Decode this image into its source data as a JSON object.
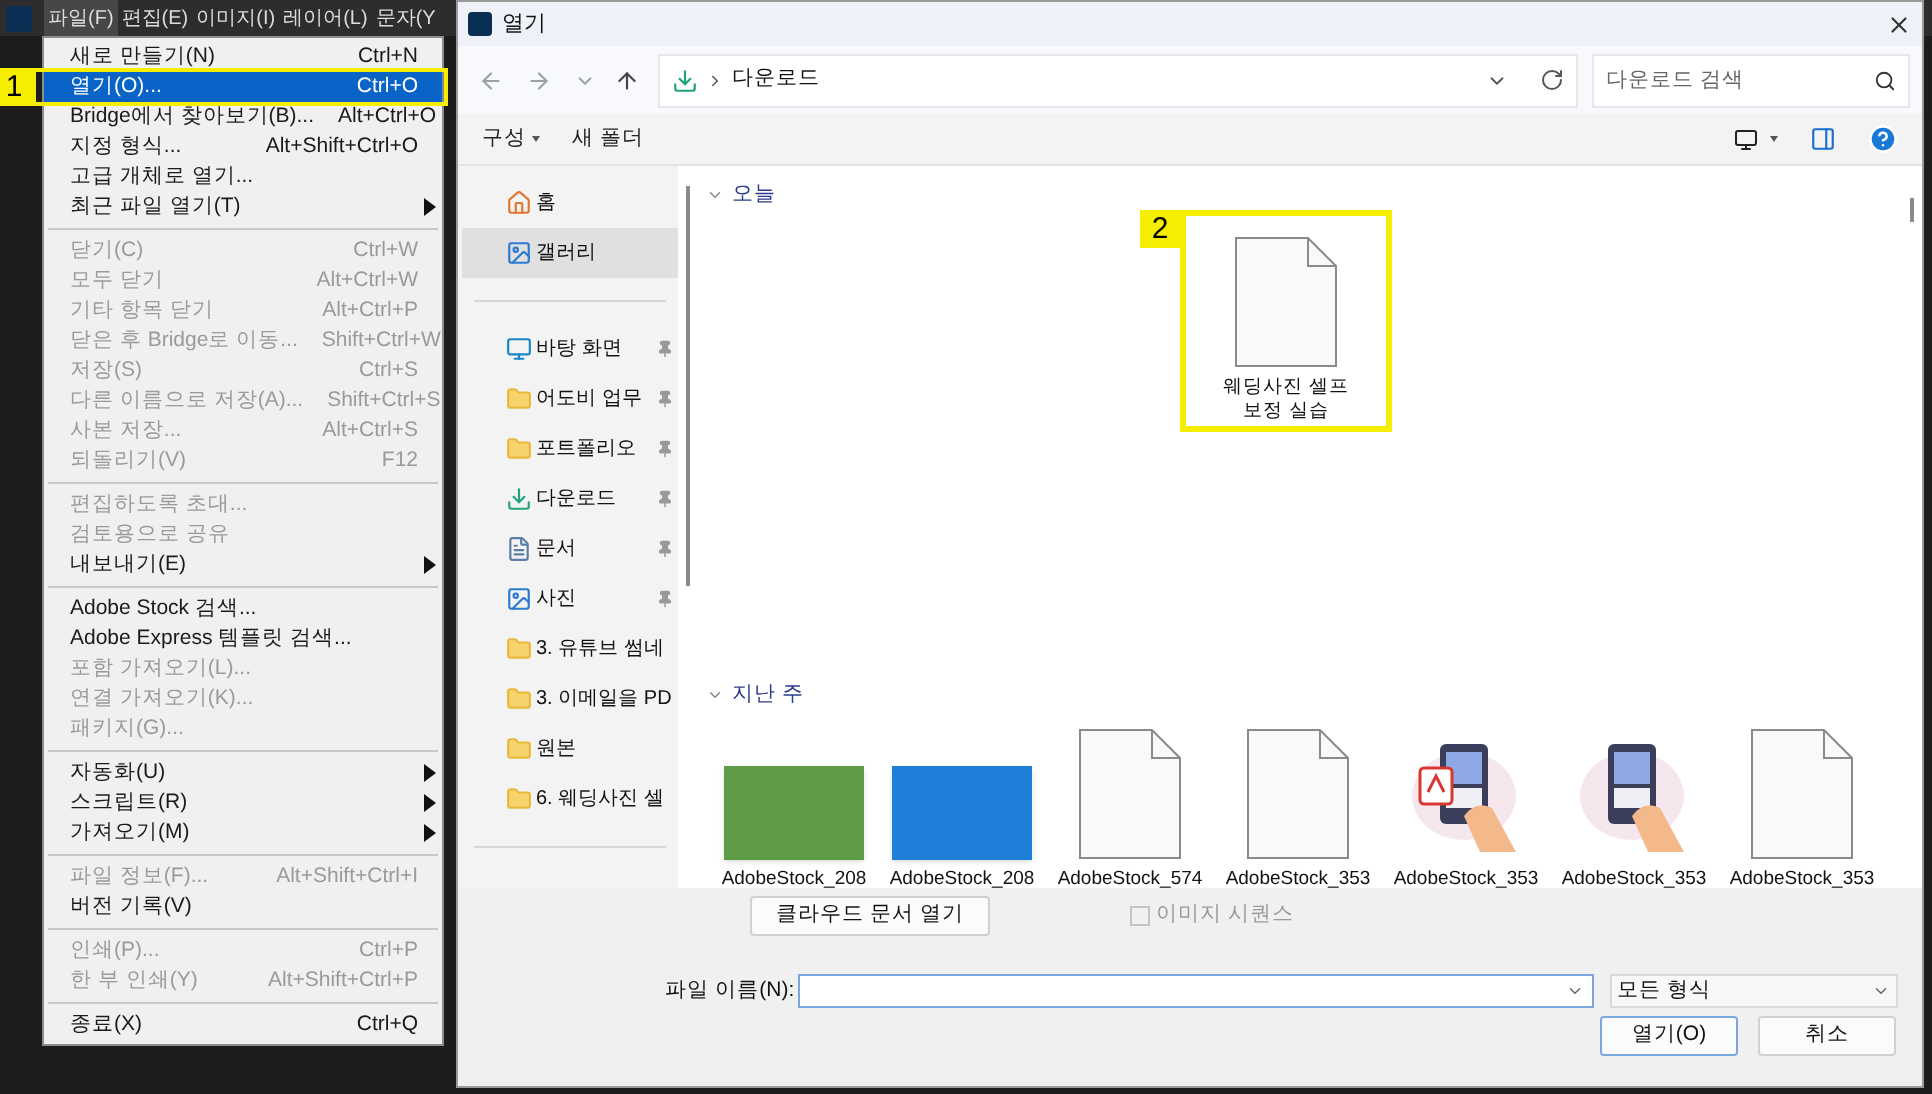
{
  "menubar": [
    {
      "label": "파일(F)",
      "selected": true
    },
    {
      "label": "편집(E)",
      "selected": false
    },
    {
      "label": "이미지(I)",
      "selected": false
    },
    {
      "label": "레이어(L)",
      "selected": false
    },
    {
      "label": "문자(Y",
      "selected": false
    }
  ],
  "file_menu": {
    "groups": [
      [
        {
          "label": "새로 만들기(N)",
          "shortcut": "Ctrl+N",
          "disabled": false,
          "submenu": false,
          "selected": false
        },
        {
          "label": "열기(O)...",
          "shortcut": "Ctrl+O",
          "disabled": false,
          "submenu": false,
          "selected": true,
          "annotation": "1"
        },
        {
          "label": "Bridge에서 찾아보기(B)...",
          "shortcut": "Alt+Ctrl+O",
          "disabled": false,
          "submenu": false,
          "selected": false
        },
        {
          "label": "지정 형식...",
          "shortcut": "Alt+Shift+Ctrl+O",
          "disabled": false,
          "submenu": false,
          "selected": false
        },
        {
          "label": "고급 개체로 열기...",
          "disabled": false,
          "submenu": false,
          "selected": false
        },
        {
          "label": "최근 파일 열기(T)",
          "disabled": false,
          "submenu": true,
          "selected": false
        }
      ],
      [
        {
          "label": "닫기(C)",
          "shortcut": "Ctrl+W",
          "disabled": true,
          "submenu": false,
          "selected": false
        },
        {
          "label": "모두 닫기",
          "shortcut": "Alt+Ctrl+W",
          "disabled": true,
          "submenu": false,
          "selected": false
        },
        {
          "label": "기타 항목 닫기",
          "shortcut": "Alt+Ctrl+P",
          "disabled": true,
          "submenu": false,
          "selected": false
        },
        {
          "label": "닫은 후 Bridge로 이동...",
          "shortcut": "Shift+Ctrl+W",
          "disabled": true,
          "submenu": false,
          "selected": false
        },
        {
          "label": "저장(S)",
          "shortcut": "Ctrl+S",
          "disabled": true,
          "submenu": false,
          "selected": false
        },
        {
          "label": "다른 이름으로 저장(A)...",
          "shortcut": "Shift+Ctrl+S",
          "disabled": true,
          "submenu": false,
          "selected": false
        },
        {
          "label": "사본 저장...",
          "shortcut": "Alt+Ctrl+S",
          "disabled": true,
          "submenu": false,
          "selected": false
        },
        {
          "label": "되돌리기(V)",
          "shortcut": "F12",
          "disabled": true,
          "submenu": false,
          "selected": false
        }
      ],
      [
        {
          "label": "편집하도록 초대...",
          "disabled": true,
          "submenu": false,
          "selected": false
        },
        {
          "label": "검토용으로 공유",
          "disabled": true,
          "submenu": false,
          "selected": false
        },
        {
          "label": "내보내기(E)",
          "disabled": false,
          "submenu": true,
          "selected": false
        }
      ],
      [
        {
          "label": "Adobe Stock 검색...",
          "disabled": false,
          "submenu": false,
          "selected": false
        },
        {
          "label": "Adobe Express 템플릿 검색...",
          "disabled": false,
          "submenu": false,
          "selected": false
        },
        {
          "label": "포함 가져오기(L)...",
          "disabled": true,
          "submenu": false,
          "selected": false
        },
        {
          "label": "연결 가져오기(K)...",
          "disabled": true,
          "submenu": false,
          "selected": false
        },
        {
          "label": "패키지(G)...",
          "disabled": true,
          "submenu": false,
          "selected": false
        }
      ],
      [
        {
          "label": "자동화(U)",
          "disabled": false,
          "submenu": true,
          "selected": false
        },
        {
          "label": "스크립트(R)",
          "disabled": false,
          "submenu": true,
          "selected": false
        },
        {
          "label": "가져오기(M)",
          "disabled": false,
          "submenu": true,
          "selected": false
        }
      ],
      [
        {
          "label": "파일 정보(F)...",
          "shortcut": "Alt+Shift+Ctrl+I",
          "disabled": true,
          "submenu": false,
          "selected": false
        },
        {
          "label": "버전 기록(V)",
          "disabled": false,
          "submenu": false,
          "selected": false
        }
      ],
      [
        {
          "label": "인쇄(P)...",
          "shortcut": "Ctrl+P",
          "disabled": true,
          "submenu": false,
          "selected": false
        },
        {
          "label": "한 부 인쇄(Y)",
          "shortcut": "Alt+Shift+Ctrl+P",
          "disabled": true,
          "submenu": false,
          "selected": false
        }
      ],
      [
        {
          "label": "종료(X)",
          "shortcut": "Ctrl+Q",
          "disabled": false,
          "submenu": false,
          "selected": false
        }
      ]
    ]
  },
  "dialog": {
    "title": "열기",
    "breadcrumb": "다운로드",
    "search": {
      "placeholder": "다운로드 검색"
    },
    "toolbar": [
      {
        "label": "구성",
        "dropdown": true
      },
      {
        "label": "새 폴더",
        "dropdown": false
      }
    ],
    "sidebar": {
      "items": [
        {
          "label": "홈",
          "kind": "home",
          "pinned": false,
          "selected": false
        },
        {
          "label": "갤러리",
          "kind": "gallery",
          "pinned": false,
          "selected": true
        },
        {
          "label": "바탕 화면",
          "kind": "desktop",
          "pinned": true,
          "selected": false
        },
        {
          "label": "어도비 업무",
          "kind": "folder",
          "pinned": true,
          "selected": false
        },
        {
          "label": "포트폴리오",
          "kind": "folder",
          "pinned": true,
          "selected": false
        },
        {
          "label": "다운로드",
          "kind": "download",
          "pinned": true,
          "selected": false
        },
        {
          "label": "문서",
          "kind": "document",
          "pinned": true,
          "selected": false
        },
        {
          "label": "사진",
          "kind": "pictures",
          "pinned": true,
          "selected": false
        },
        {
          "label": "3. 유튜브 썸네",
          "kind": "folder",
          "pinned": false,
          "selected": false
        },
        {
          "label": "3. 이메일을 PD",
          "kind": "folder",
          "pinned": false,
          "selected": false
        },
        {
          "label": "원본",
          "kind": "folder",
          "pinned": false,
          "selected": false
        },
        {
          "label": "6. 웨딩사진 셀",
          "kind": "folder",
          "pinned": false,
          "selected": false
        }
      ]
    },
    "groups": [
      {
        "title": "오늘",
        "expanded": true,
        "files": [
          {
            "name": "웨딩사진 셀프보정 실습",
            "kind": "document",
            "annotation": "2"
          }
        ]
      },
      {
        "title": "지난 주",
        "expanded": true,
        "files": [
          {
            "name": "AdobeStock_208",
            "kind": "photo",
            "color": "#5e9c48"
          },
          {
            "name": "AdobeStock_208",
            "kind": "photo",
            "color": "#1e7fd8"
          },
          {
            "name": "AdobeStock_574",
            "kind": "document"
          },
          {
            "name": "AdobeStock_353",
            "kind": "document"
          },
          {
            "name": "AdobeStock_353",
            "kind": "pdfart"
          },
          {
            "name": "AdobeStock_353",
            "kind": "phoneart"
          },
          {
            "name": "AdobeStock_353",
            "kind": "document"
          }
        ]
      }
    ],
    "cloud_button": "클라우드 문서 열기",
    "image_sequence": {
      "label": "이미지 시퀀스",
      "checked": false,
      "disabled": true
    },
    "filename": {
      "label": "파일 이름(N):"
    },
    "filetype": "모든 형식",
    "buttons": [
      {
        "label": "열기(O)",
        "kind": "primary"
      },
      {
        "label": "취소",
        "kind": "secondary"
      }
    ]
  }
}
